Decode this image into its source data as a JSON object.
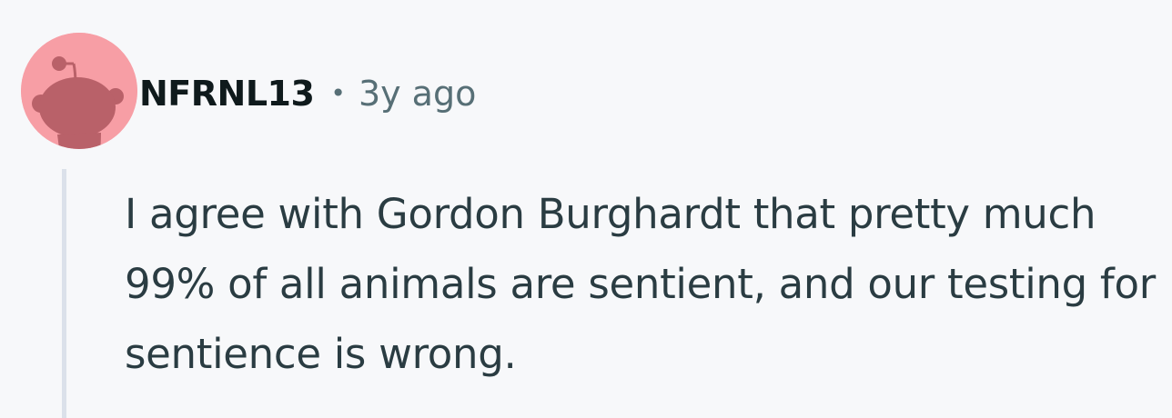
{
  "comment": {
    "author": "NFRNL13",
    "separator": "•",
    "age": "3y ago",
    "body": "I agree with Gordon Burghardt that pretty much 99% of all animals are sentient, and our testing for sentience is wrong.",
    "avatar_icon": "snoo-avatar-icon"
  },
  "colors": {
    "background": "#f7f8fa",
    "avatar_bg": "#f79ea5",
    "avatar_figure": "#b96169",
    "username": "#0f1a1c",
    "meta": "#576f76",
    "body_text": "#2a3c42",
    "thread_line": "#dbe1ea"
  }
}
